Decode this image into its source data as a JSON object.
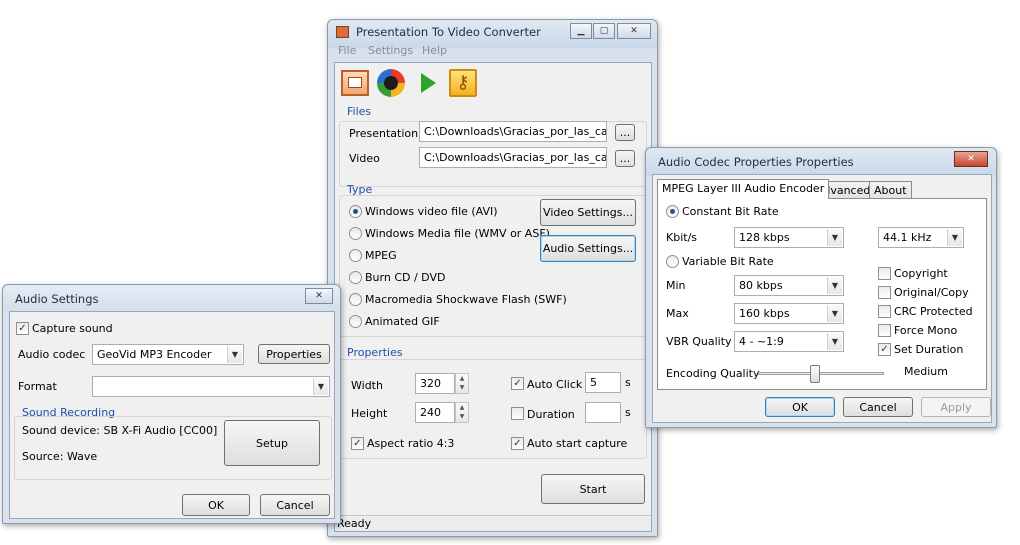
{
  "main": {
    "title": "Presentation To Video Converter",
    "menu": [
      "File",
      "Settings",
      "Help"
    ],
    "toolbar_icons": [
      "presentation-icon",
      "media-icon",
      "play-icon",
      "key-icon"
    ],
    "files": {
      "group_title": "Files",
      "presentation_label": "Presentation",
      "presentation_value": "C:\\Downloads\\Gracias_por_las_cadene",
      "video_label": "Video",
      "video_value": "C:\\Downloads\\Gracias_por_las_cadene",
      "browse_label": "..."
    },
    "type": {
      "group_title": "Type",
      "options": [
        "Windows video file (AVI)",
        "Windows Media file (WMV or ASF)",
        "MPEG",
        "Burn CD / DVD",
        "Macromedia Shockwave Flash (SWF)",
        "Animated GIF"
      ],
      "selected_index": 0,
      "video_settings_label": "Video Settings...",
      "audio_settings_label": "Audio Settings..."
    },
    "properties": {
      "group_title": "Properties",
      "width_label": "Width",
      "width_value": "320",
      "height_label": "Height",
      "height_value": "240",
      "aspect_label": "Aspect ratio 4:3",
      "aspect_checked": true,
      "auto_click_label": "Auto Click",
      "auto_click_checked": true,
      "auto_click_value": "5",
      "auto_click_unit": "s",
      "duration_label": "Duration",
      "duration_checked": false,
      "duration_value": "",
      "duration_unit": "s",
      "auto_start_label": "Auto start capture",
      "auto_start_checked": true
    },
    "start_label": "Start",
    "status": "Ready"
  },
  "audio_settings": {
    "title": "Audio Settings",
    "capture_label": "Capture sound",
    "capture_checked": true,
    "codec_label": "Audio codec",
    "codec_value": "GeoVid MP3 Encoder",
    "properties_label": "Properties",
    "format_label": "Format",
    "format_value": "",
    "recording": {
      "group_title": "Sound Recording",
      "device": "Sound device: SB X-Fi Audio [CC00]",
      "source": "Source: Wave",
      "setup_label": "Setup"
    },
    "ok_label": "OK",
    "cancel_label": "Cancel"
  },
  "codec_props": {
    "title": "Audio Codec Properties Properties",
    "tabs": [
      "MPEG Layer III Audio Encoder",
      "Advanced",
      "About"
    ],
    "constant_label": "Constant Bit Rate",
    "kbits_label": "Kbit/s",
    "kbits_value": "128 kbps",
    "freq_value": "44.1 kHz",
    "variable_label": "Variable Bit Rate",
    "min_label": "Min",
    "min_value": "80 kbps",
    "max_label": "Max",
    "max_value": "160 kbps",
    "vbr_label": "VBR Quality",
    "vbr_value": "4 - ~1:9",
    "flags": [
      {
        "label": "Copyright",
        "checked": false
      },
      {
        "label": "Original/Copy",
        "checked": false
      },
      {
        "label": "CRC Protected",
        "checked": false
      },
      {
        "label": "Force Mono",
        "checked": false
      },
      {
        "label": "Set Duration",
        "checked": true
      }
    ],
    "encoding_label": "Encoding Quality",
    "encoding_value": "Medium",
    "encoding_level_fraction": 0.45,
    "ok_label": "OK",
    "cancel_label": "Cancel",
    "apply_label": "Apply"
  }
}
